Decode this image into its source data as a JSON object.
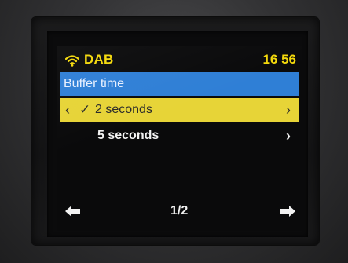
{
  "status": {
    "source_icon": "wifi-signal-icon",
    "source": "DAB",
    "time": "16 56"
  },
  "menu": {
    "title": "Buffer time",
    "items": [
      {
        "label": "2 seconds",
        "selected": true,
        "check_icon": "check-icon",
        "back_glyph": "‹",
        "check_glyph": "✓",
        "next_glyph": "›"
      },
      {
        "label": "5 seconds",
        "selected": false,
        "next_glyph": "›"
      }
    ]
  },
  "navigation": {
    "left_icon": "arrow-left-icon",
    "right_icon": "arrow-right-icon",
    "page": "1/2"
  },
  "colors": {
    "status_text": "#f4d90a",
    "title_bar": "#2f7fd6",
    "selected_row": "#e7d437",
    "screen_bg": "#0a0a0b",
    "text": "#f2f2f2"
  }
}
